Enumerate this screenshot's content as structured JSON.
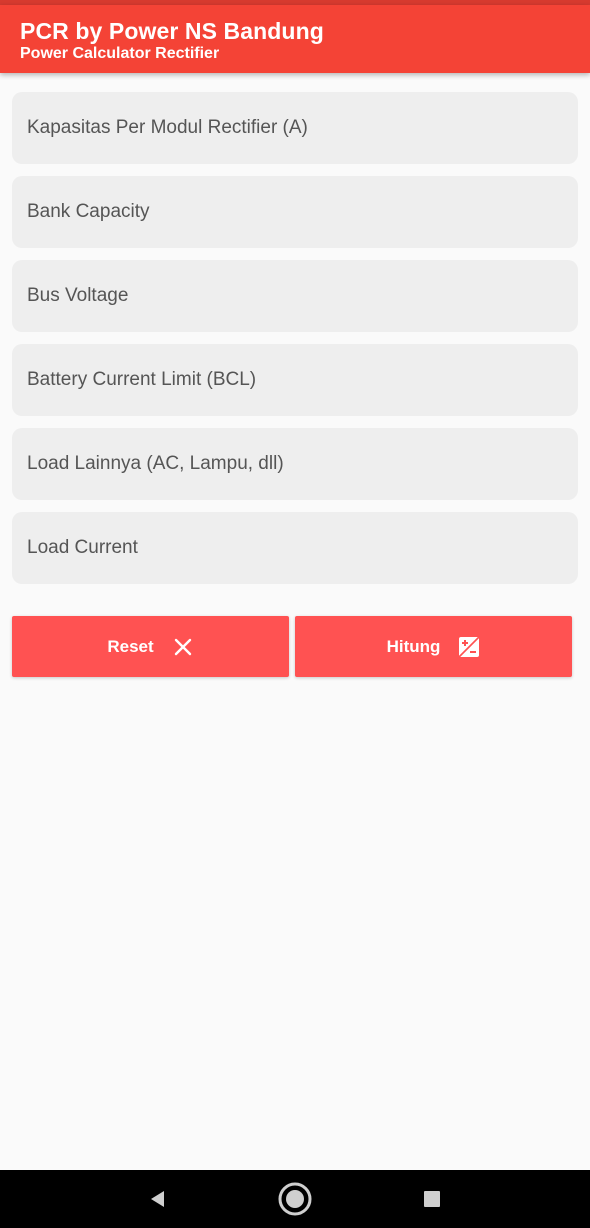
{
  "app_bar": {
    "title": "PCR by Power NS Bandung",
    "subtitle": "Power Calculator Rectifier",
    "color": "#f44336"
  },
  "form": {
    "fields": [
      {
        "placeholder": "Kapasitas Per Modul Rectifier (A)",
        "value": ""
      },
      {
        "placeholder": "Bank Capacity",
        "value": ""
      },
      {
        "placeholder": "Bus Voltage",
        "value": ""
      },
      {
        "placeholder": "Battery Current Limit (BCL)",
        "value": ""
      },
      {
        "placeholder": "Load Lainnya (AC, Lampu, dll)",
        "value": ""
      },
      {
        "placeholder": "Load Current",
        "value": ""
      }
    ]
  },
  "actions": {
    "reset_label": "Reset",
    "reset_icon": "close-icon",
    "calculate_label": "Hitung",
    "calculate_icon": "calculate-icon",
    "button_color": "#ff5252"
  },
  "system_nav": {
    "back_icon": "back-triangle-icon",
    "home_icon": "home-circle-icon",
    "recents_icon": "recents-square-icon"
  }
}
